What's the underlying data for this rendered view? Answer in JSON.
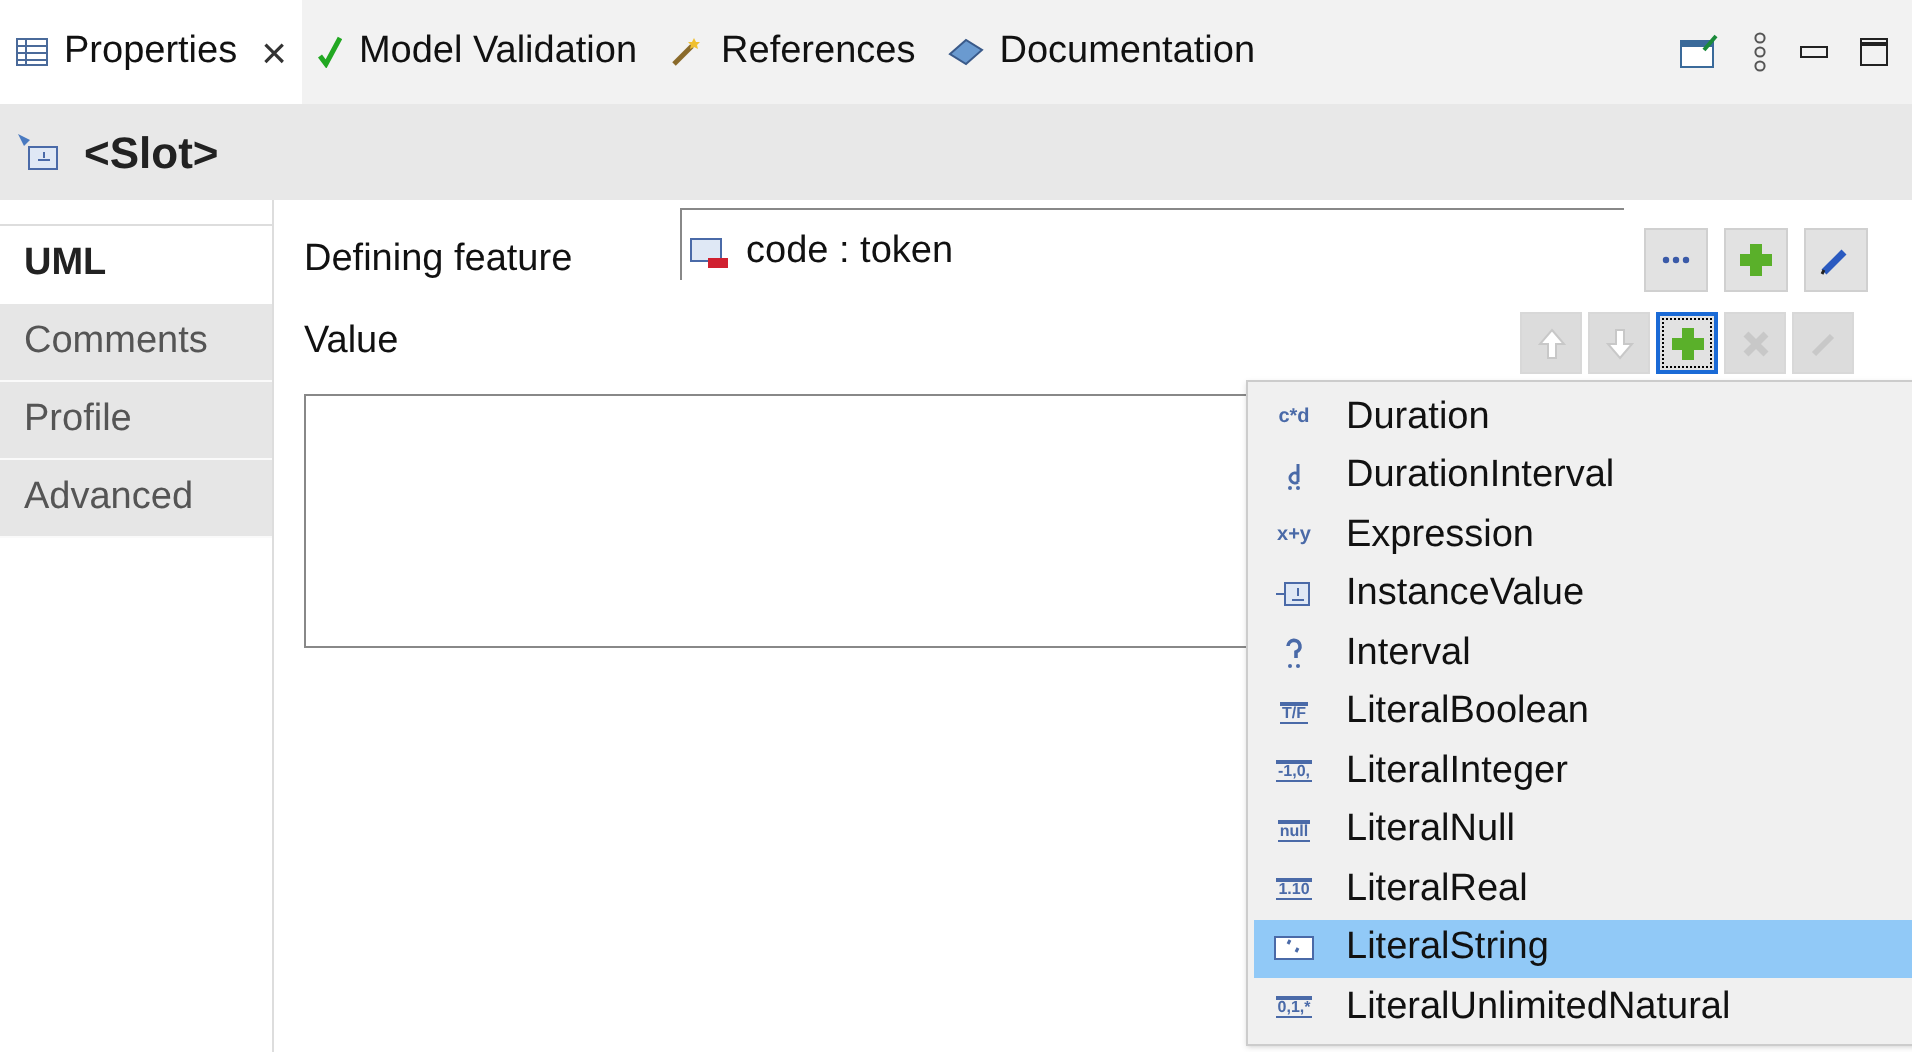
{
  "view_tabs": [
    {
      "label": "Properties",
      "selected": true,
      "close": "×",
      "kind": "properties"
    },
    {
      "label": "Model Validation",
      "selected": false,
      "kind": "validation"
    },
    {
      "label": "References",
      "selected": false,
      "kind": "references"
    },
    {
      "label": "Documentation",
      "selected": false,
      "kind": "documentation"
    }
  ],
  "title": "<Slot>",
  "side_tabs": [
    {
      "label": "UML",
      "selected": true
    },
    {
      "label": "Comments",
      "selected": false
    },
    {
      "label": "Profile",
      "selected": false
    },
    {
      "label": "Advanced",
      "selected": false
    }
  ],
  "defining_feature": {
    "label": "Defining feature",
    "value": "code : token"
  },
  "value_section": {
    "label": "Value",
    "buttons": [
      {
        "kind": "up",
        "disabled": true,
        "focused": false
      },
      {
        "kind": "down",
        "disabled": true,
        "focused": false
      },
      {
        "kind": "add",
        "disabled": false,
        "focused": true
      },
      {
        "kind": "delete",
        "disabled": true,
        "focused": false
      },
      {
        "kind": "edit",
        "disabled": true,
        "focused": false
      }
    ]
  },
  "menu": [
    {
      "label": "Duration",
      "kind": "text",
      "icon_text": "c*d",
      "selected": false
    },
    {
      "label": "DurationInterval",
      "kind": "d",
      "selected": false
    },
    {
      "label": "Expression",
      "kind": "text",
      "icon_text": "x+y",
      "selected": false
    },
    {
      "label": "InstanceValue",
      "kind": "instance",
      "selected": false
    },
    {
      "label": "Interval",
      "kind": "question",
      "selected": false
    },
    {
      "label": "LiteralBoolean",
      "kind": "boxed",
      "icon_text": "T/F",
      "selected": false
    },
    {
      "label": "LiteralInteger",
      "kind": "boxed",
      "icon_text": "-1,0,",
      "selected": false
    },
    {
      "label": "LiteralNull",
      "kind": "boxed",
      "icon_text": "null",
      "selected": false
    },
    {
      "label": "LiteralReal",
      "kind": "boxed",
      "icon_text": "1.10",
      "selected": false
    },
    {
      "label": "LiteralString",
      "kind": "quote",
      "selected": true
    },
    {
      "label": "LiteralUnlimitedNatural",
      "kind": "boxed",
      "icon_text": "0,1,*",
      "selected": false
    }
  ]
}
